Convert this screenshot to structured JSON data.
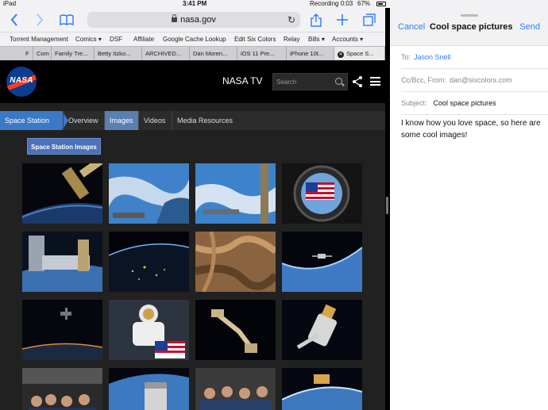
{
  "status_bar": {
    "device": "iPad",
    "time": "3:41 PM",
    "recording": "Recording  0:03",
    "battery": "67%"
  },
  "safari": {
    "url": "nasa.gov",
    "icons": [
      "back-icon",
      "forward-icon",
      "bookmarks-icon",
      "reload-icon",
      "share-icon",
      "new-tab-icon",
      "tabs-icon"
    ],
    "bookmarks": [
      "Torrent Management",
      "Comics ▾",
      "DSF",
      "Affiliate",
      "Google Cache Lookup",
      "Edit Six Colors",
      "Relay",
      "Bills ▾",
      "Accounts ▾"
    ],
    "tabs": [
      "F",
      "Com",
      "Family Tre...",
      "Betty Itzko...",
      "ARCHIVED...",
      "Dan Moren...",
      "iOS 11 Pre...",
      "iPhone 10t...",
      "Space S..."
    ]
  },
  "nasa": {
    "logo_text": "NASA",
    "tv_label": "NASA TV",
    "search_placeholder": "Search",
    "subnav": {
      "section": "Space Station",
      "links": [
        "Overview",
        "Images",
        "Videos",
        "Media Resources"
      ],
      "active": "Images"
    },
    "gallery_button": "Space Station Images",
    "thumbnails": [
      "station-arm-over-earth",
      "earth-ocean-from-station",
      "earth-ocean-truss",
      "flag-in-window",
      "station-modules-earth",
      "earth-at-night-limb",
      "desert-terrain",
      "capsule-over-limb",
      "station-at-night",
      "astronaut-spacewalk-flag",
      "robotic-arm-dark",
      "cygnus-capture",
      "crew-in-cupola",
      "capsule-over-earth",
      "crew-group-photo",
      "cargo-ship-over-earth"
    ]
  },
  "mail": {
    "cancel": "Cancel",
    "title": "Cool space pictures",
    "send": "Send",
    "to_label": "To:",
    "to_value": "Jason Snell",
    "cc_label": "Cc/Bcc, From:",
    "cc_value": "dan@sixcolors.com",
    "subject_label": "Subject:",
    "subject_value": "Cool space pictures",
    "body": "I know how you love space, so here are some cool images!"
  },
  "colors": {
    "ios_blue": "#2f7cf6",
    "nasa_blue": "#0b3d91",
    "nasa_red": "#fc3d21",
    "subnav_blue": "#3a79c6",
    "page_dark": "#212121"
  }
}
